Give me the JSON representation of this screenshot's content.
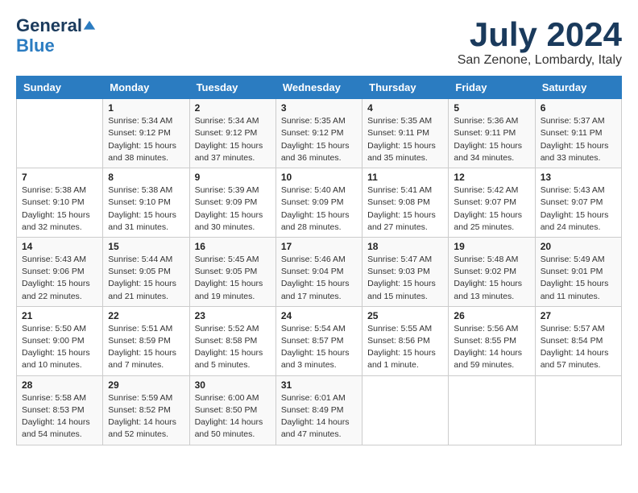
{
  "header": {
    "logo_line1": "General",
    "logo_line2": "Blue",
    "month": "July 2024",
    "location": "San Zenone, Lombardy, Italy"
  },
  "days_of_week": [
    "Sunday",
    "Monday",
    "Tuesday",
    "Wednesday",
    "Thursday",
    "Friday",
    "Saturday"
  ],
  "weeks": [
    [
      {
        "num": "",
        "sunrise": "",
        "sunset": "",
        "daylight": ""
      },
      {
        "num": "1",
        "sunrise": "Sunrise: 5:34 AM",
        "sunset": "Sunset: 9:12 PM",
        "daylight": "Daylight: 15 hours and 38 minutes."
      },
      {
        "num": "2",
        "sunrise": "Sunrise: 5:34 AM",
        "sunset": "Sunset: 9:12 PM",
        "daylight": "Daylight: 15 hours and 37 minutes."
      },
      {
        "num": "3",
        "sunrise": "Sunrise: 5:35 AM",
        "sunset": "Sunset: 9:12 PM",
        "daylight": "Daylight: 15 hours and 36 minutes."
      },
      {
        "num": "4",
        "sunrise": "Sunrise: 5:35 AM",
        "sunset": "Sunset: 9:11 PM",
        "daylight": "Daylight: 15 hours and 35 minutes."
      },
      {
        "num": "5",
        "sunrise": "Sunrise: 5:36 AM",
        "sunset": "Sunset: 9:11 PM",
        "daylight": "Daylight: 15 hours and 34 minutes."
      },
      {
        "num": "6",
        "sunrise": "Sunrise: 5:37 AM",
        "sunset": "Sunset: 9:11 PM",
        "daylight": "Daylight: 15 hours and 33 minutes."
      }
    ],
    [
      {
        "num": "7",
        "sunrise": "Sunrise: 5:38 AM",
        "sunset": "Sunset: 9:10 PM",
        "daylight": "Daylight: 15 hours and 32 minutes."
      },
      {
        "num": "8",
        "sunrise": "Sunrise: 5:38 AM",
        "sunset": "Sunset: 9:10 PM",
        "daylight": "Daylight: 15 hours and 31 minutes."
      },
      {
        "num": "9",
        "sunrise": "Sunrise: 5:39 AM",
        "sunset": "Sunset: 9:09 PM",
        "daylight": "Daylight: 15 hours and 30 minutes."
      },
      {
        "num": "10",
        "sunrise": "Sunrise: 5:40 AM",
        "sunset": "Sunset: 9:09 PM",
        "daylight": "Daylight: 15 hours and 28 minutes."
      },
      {
        "num": "11",
        "sunrise": "Sunrise: 5:41 AM",
        "sunset": "Sunset: 9:08 PM",
        "daylight": "Daylight: 15 hours and 27 minutes."
      },
      {
        "num": "12",
        "sunrise": "Sunrise: 5:42 AM",
        "sunset": "Sunset: 9:07 PM",
        "daylight": "Daylight: 15 hours and 25 minutes."
      },
      {
        "num": "13",
        "sunrise": "Sunrise: 5:43 AM",
        "sunset": "Sunset: 9:07 PM",
        "daylight": "Daylight: 15 hours and 24 minutes."
      }
    ],
    [
      {
        "num": "14",
        "sunrise": "Sunrise: 5:43 AM",
        "sunset": "Sunset: 9:06 PM",
        "daylight": "Daylight: 15 hours and 22 minutes."
      },
      {
        "num": "15",
        "sunrise": "Sunrise: 5:44 AM",
        "sunset": "Sunset: 9:05 PM",
        "daylight": "Daylight: 15 hours and 21 minutes."
      },
      {
        "num": "16",
        "sunrise": "Sunrise: 5:45 AM",
        "sunset": "Sunset: 9:05 PM",
        "daylight": "Daylight: 15 hours and 19 minutes."
      },
      {
        "num": "17",
        "sunrise": "Sunrise: 5:46 AM",
        "sunset": "Sunset: 9:04 PM",
        "daylight": "Daylight: 15 hours and 17 minutes."
      },
      {
        "num": "18",
        "sunrise": "Sunrise: 5:47 AM",
        "sunset": "Sunset: 9:03 PM",
        "daylight": "Daylight: 15 hours and 15 minutes."
      },
      {
        "num": "19",
        "sunrise": "Sunrise: 5:48 AM",
        "sunset": "Sunset: 9:02 PM",
        "daylight": "Daylight: 15 hours and 13 minutes."
      },
      {
        "num": "20",
        "sunrise": "Sunrise: 5:49 AM",
        "sunset": "Sunset: 9:01 PM",
        "daylight": "Daylight: 15 hours and 11 minutes."
      }
    ],
    [
      {
        "num": "21",
        "sunrise": "Sunrise: 5:50 AM",
        "sunset": "Sunset: 9:00 PM",
        "daylight": "Daylight: 15 hours and 10 minutes."
      },
      {
        "num": "22",
        "sunrise": "Sunrise: 5:51 AM",
        "sunset": "Sunset: 8:59 PM",
        "daylight": "Daylight: 15 hours and 7 minutes."
      },
      {
        "num": "23",
        "sunrise": "Sunrise: 5:52 AM",
        "sunset": "Sunset: 8:58 PM",
        "daylight": "Daylight: 15 hours and 5 minutes."
      },
      {
        "num": "24",
        "sunrise": "Sunrise: 5:54 AM",
        "sunset": "Sunset: 8:57 PM",
        "daylight": "Daylight: 15 hours and 3 minutes."
      },
      {
        "num": "25",
        "sunrise": "Sunrise: 5:55 AM",
        "sunset": "Sunset: 8:56 PM",
        "daylight": "Daylight: 15 hours and 1 minute."
      },
      {
        "num": "26",
        "sunrise": "Sunrise: 5:56 AM",
        "sunset": "Sunset: 8:55 PM",
        "daylight": "Daylight: 14 hours and 59 minutes."
      },
      {
        "num": "27",
        "sunrise": "Sunrise: 5:57 AM",
        "sunset": "Sunset: 8:54 PM",
        "daylight": "Daylight: 14 hours and 57 minutes."
      }
    ],
    [
      {
        "num": "28",
        "sunrise": "Sunrise: 5:58 AM",
        "sunset": "Sunset: 8:53 PM",
        "daylight": "Daylight: 14 hours and 54 minutes."
      },
      {
        "num": "29",
        "sunrise": "Sunrise: 5:59 AM",
        "sunset": "Sunset: 8:52 PM",
        "daylight": "Daylight: 14 hours and 52 minutes."
      },
      {
        "num": "30",
        "sunrise": "Sunrise: 6:00 AM",
        "sunset": "Sunset: 8:50 PM",
        "daylight": "Daylight: 14 hours and 50 minutes."
      },
      {
        "num": "31",
        "sunrise": "Sunrise: 6:01 AM",
        "sunset": "Sunset: 8:49 PM",
        "daylight": "Daylight: 14 hours and 47 minutes."
      },
      {
        "num": "",
        "sunrise": "",
        "sunset": "",
        "daylight": ""
      },
      {
        "num": "",
        "sunrise": "",
        "sunset": "",
        "daylight": ""
      },
      {
        "num": "",
        "sunrise": "",
        "sunset": "",
        "daylight": ""
      }
    ]
  ]
}
